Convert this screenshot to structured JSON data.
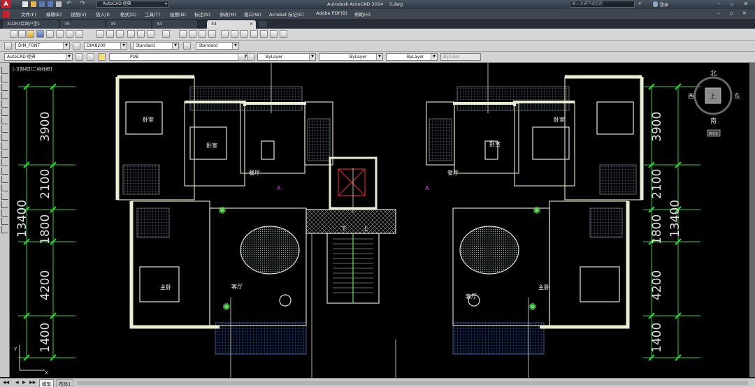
{
  "window": {
    "title": "Autodesk AutoCAD 2014    3.dwg",
    "qat_workspace": "AutoCAD 经典",
    "search_placeholder": "键入关键字或短语",
    "signin": "登录"
  },
  "menu": [
    "文件(F)",
    "编辑(E)",
    "视图(V)",
    "插入(I)",
    "格式(O)",
    "工具(T)",
    "绘图(D)",
    "标注(N)",
    "修改(M)",
    "窗口(W)",
    "Acrobat 标记(C)",
    "Adobe PDF(B)",
    "帮助(H)"
  ],
  "file_tabs": [
    "3LDR3绘图户型1",
    "35",
    "35",
    "44",
    "34"
  ],
  "styles": {
    "text_style": "DIM_FONT",
    "dim_style": "DIM8200",
    "table_style": "Standard",
    "multileader_style": "Standard"
  },
  "workspace_combo": "AutoCAD 经典",
  "layer_combo": "PUB",
  "properties": {
    "color": "ByLayer",
    "linetype": "ByLayer",
    "lineweight": "ByLayer",
    "plotstyle": "ByColor"
  },
  "viewport_label": "[-][俯视][二维线框]",
  "viewcube": {
    "north": "北",
    "south": "南",
    "east": "东",
    "west": "西",
    "top": "上",
    "wcs": "WCS"
  },
  "drawing": {
    "dims_left": [
      "3900",
      "2100",
      "1800",
      "4200",
      "1400"
    ],
    "dims_right": [
      "3900",
      "2100",
      "1800",
      "4200",
      "1400"
    ],
    "overall": "13400",
    "rooms": {
      "bedroom": "卧室",
      "dining": "餐厅",
      "living": "客厅",
      "master": "主卧",
      "down": "下",
      "up": "上",
      "marker": "A"
    }
  },
  "status": {
    "model_tab": "模型",
    "layout_tab": "布局1"
  }
}
